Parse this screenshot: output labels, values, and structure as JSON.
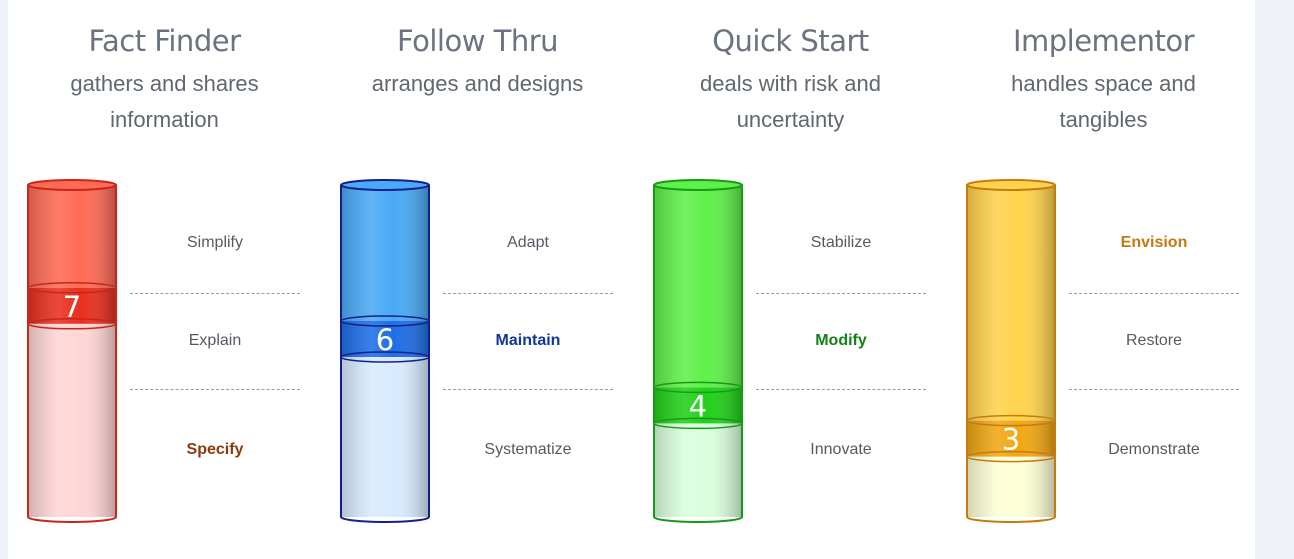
{
  "modes": [
    {
      "title": "Fact Finder",
      "description": "gathers and shares information",
      "score": 7,
      "zones": [
        "Simplify",
        "Explain",
        "Specify"
      ],
      "highlight_zone": 2,
      "colors": {
        "dark": "#c9261b",
        "fill": "#ff6a55",
        "band": "#e8301f",
        "empty": "#ffd6d6",
        "label": "#8b3a0e"
      }
    },
    {
      "title": "Follow Thru",
      "description": "arranges and designs",
      "score": 6,
      "zones": [
        "Adapt",
        "Maintain",
        "Systematize"
      ],
      "highlight_zone": 1,
      "colors": {
        "dark": "#12208f",
        "fill": "#4aaaf5",
        "band": "#1e6ee6",
        "empty": "#d8ebff",
        "label": "#14369a"
      }
    },
    {
      "title": "Quick Start",
      "description": "deals with risk and uncertainty",
      "score": 4,
      "zones": [
        "Stabilize",
        "Modify",
        "Innovate"
      ],
      "highlight_zone": 1,
      "colors": {
        "dark": "#169b16",
        "fill": "#60f04a",
        "band": "#22d01a",
        "empty": "#d9ffdd",
        "label": "#16801a"
      }
    },
    {
      "title": "Implementor",
      "description": "handles space and tangibles",
      "score": 3,
      "zones": [
        "Envision",
        "Restore",
        "Demonstrate"
      ],
      "highlight_zone": 0,
      "colors": {
        "dark": "#c67b0c",
        "fill": "#ffd34d",
        "band": "#f0a713",
        "empty": "#fdffd6",
        "label": "#c47a12"
      }
    }
  ]
}
